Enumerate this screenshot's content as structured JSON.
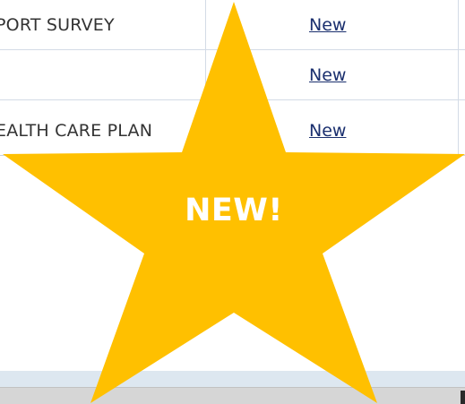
{
  "table": {
    "rows": [
      {
        "name": "PORT SURVEY",
        "action": "New"
      },
      {
        "name": "",
        "action": "New"
      },
      {
        "name": "EALTH CARE PLAN",
        "action": "New"
      }
    ]
  },
  "badge": {
    "label": "NEW!",
    "icon": "star-icon",
    "color": "#FFC000"
  },
  "colors": {
    "link": "#1a2f6e",
    "grid": "#d3dbe6",
    "scrollbar": "#dde7f0",
    "footer": "#d6d6d6"
  }
}
